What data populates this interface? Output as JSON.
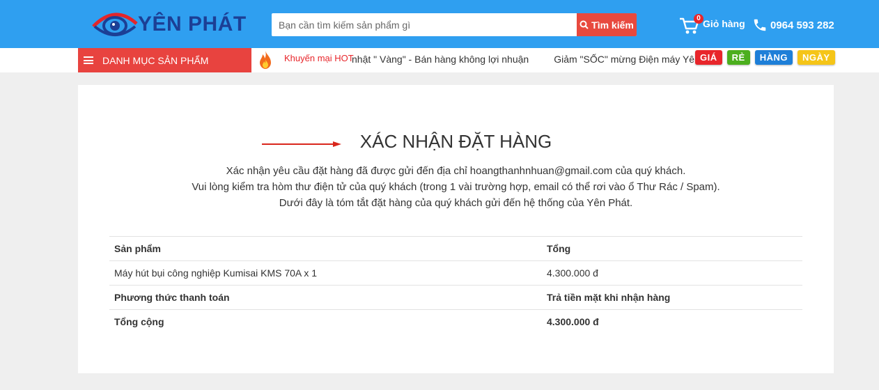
{
  "header": {
    "brand": "YÊN PHÁT",
    "search_placeholder": "Bạn cần tìm kiếm sản phẩm gì",
    "search_button": "Tìm kiếm",
    "cart_count": "0",
    "cart_label": "Giỏ hàng",
    "phone": "0964 593 282"
  },
  "nav": {
    "menu_label": "DANH MỤC SẢN PHẨM",
    "hot_label": "Khuyến mại HOT",
    "ticker": [
      "nhật \" Vàng\" - Bán hàng không lợi nhuận",
      "Giảm \"SỐC\" mừng Điện máy Yên Phát"
    ],
    "badges": [
      {
        "text": "GIÁ",
        "color": "#e8262b"
      },
      {
        "text": "RẺ",
        "color": "#4caf1e"
      },
      {
        "text": "HÀNG",
        "color": "#1e7fd8"
      },
      {
        "text": "NGÀY",
        "color": "#f5c518"
      }
    ]
  },
  "confirmation": {
    "title": "XÁC NHẬN ĐẶT HÀNG",
    "line1": "Xác nhận yêu cầu đặt hàng đã được gửi đến địa chỉ hoangthanhnhuan@gmail.com của quý khách.",
    "line2": "Vui lòng kiểm tra hòm thư điện tử của quý khách (trong 1 vài trường hợp, email có thể rơi vào ổ Thư Rác / Spam).",
    "line3": "Dưới đây là tóm tắt đặt hàng của quý khách gửi đến hệ thống của Yên Phát."
  },
  "order": {
    "header_product": "Sản phẩm",
    "header_total": "Tổng",
    "item_name": "Máy hút bụi công nghiệp Kumisai KMS 70A x 1",
    "item_total": "4.300.000 đ",
    "payment_label": "Phương thức thanh toán",
    "payment_value": "Trả tiền mặt khi nhận hàng",
    "grand_label": "Tổng cộng",
    "grand_value": "4.300.000 đ"
  },
  "colors": {
    "header_bg": "#2f9ff0",
    "accent_red": "#e8433f",
    "brand_navy": "#1c3f95"
  }
}
